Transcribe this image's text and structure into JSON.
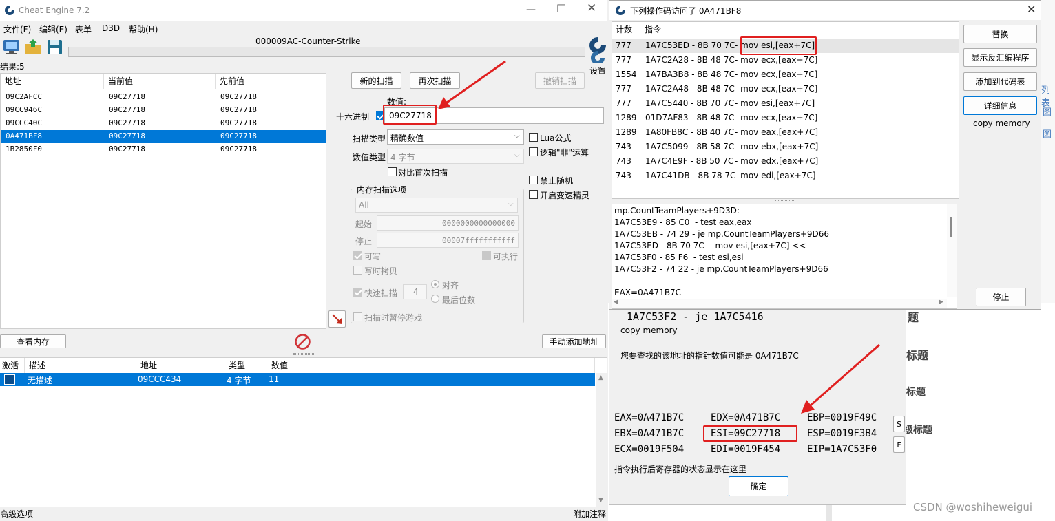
{
  "main": {
    "title": "Cheat Engine 7.2",
    "menu": [
      "文件(F)",
      "编辑(E)",
      "表单",
      "D3D",
      "帮助(H)"
    ],
    "process": "000009AC-Counter-Strike",
    "settings_label": "设置",
    "results_label": "结果:5",
    "results_headers": [
      "地址",
      "当前值",
      "先前值"
    ],
    "results": [
      [
        "09C2AFCC",
        "09C27718",
        "09C27718"
      ],
      [
        "09CC946C",
        "09C27718",
        "09C27718"
      ],
      [
        "09CCC40C",
        "09C27718",
        "09C27718"
      ],
      [
        "0A471BF8",
        "09C27718",
        "09C27718"
      ],
      [
        "1B2850F0",
        "09C27718",
        "09C27718"
      ]
    ],
    "new_scan": "新的扫描",
    "next_scan": "再次扫描",
    "undo_scan": "撤销扫描",
    "value_label": "数值:",
    "hex_label": "十六进制",
    "value": "09C27718",
    "scan_type_label": "扫描类型",
    "scan_type": "精确数值",
    "value_type_label": "数值类型",
    "value_type": "4 字节",
    "compare_first": "对比首次扫描",
    "lua_formula": "Lua公式",
    "logic_not": "逻辑\"非\"运算",
    "no_random": "禁止随机",
    "speedhack": "开启变速精灵",
    "mem_options": "内存扫描选项",
    "mem_region": "All",
    "start_label": "起始",
    "start_value": "0000000000000000",
    "stop_label": "停止",
    "stop_value": "00007fffffffffff",
    "writable": "可写",
    "executable": "可执行",
    "copy_on_write": "写时拷贝",
    "fast_scan": "快速扫描",
    "fast_scan_value": "4",
    "align": "对齐",
    "last_digits": "最后位数",
    "pause_game": "扫描时暂停游戏",
    "view_memory": "查看内存",
    "add_address": "手动添加地址",
    "table_headers": [
      "激活",
      "描述",
      "地址",
      "类型",
      "数值"
    ],
    "table_row": {
      "desc": "无描述",
      "addr": "09CCC434",
      "type": "4 字节",
      "value": "11"
    },
    "advanced": "高级选项",
    "comments": "附加注释"
  },
  "dialog": {
    "title": "下列操作码访问了 0A471BF8",
    "headers": [
      "计数",
      "指令"
    ],
    "rows": [
      {
        "count": "777",
        "addr": "1A7C53ED - 8B 70 7C",
        "instr": "- mov esi,[eax+7C]"
      },
      {
        "count": "777",
        "addr": "1A7C2A28 - 8B 48 7C",
        "instr": "- mov ecx,[eax+7C]"
      },
      {
        "count": "1554",
        "addr": "1A7BA3B8 - 8B 48 7C",
        "instr": "- mov ecx,[eax+7C]"
      },
      {
        "count": "777",
        "addr": "1A7C2A48 - 8B 48 7C",
        "instr": "- mov ecx,[eax+7C]"
      },
      {
        "count": "777",
        "addr": "1A7C5440 - 8B 70 7C",
        "instr": "- mov esi,[eax+7C]"
      },
      {
        "count": "1289",
        "addr": "01D7AF83 - 8B 48 7C",
        "instr": "- mov ecx,[eax+7C]"
      },
      {
        "count": "1289",
        "addr": "1A80FB8C - 8B 40 7C",
        "instr": "- mov eax,[eax+7C]"
      },
      {
        "count": "743",
        "addr": "1A7C5099 - 8B 58 7C",
        "instr": "- mov ebx,[eax+7C]"
      },
      {
        "count": "743",
        "addr": "1A7C4E9F - 8B 50 7C",
        "instr": "- mov edx,[eax+7C]"
      },
      {
        "count": "743",
        "addr": "1A7C41DB - 8B 78 7C",
        "instr": "- mov edi,[eax+7C]"
      }
    ],
    "buttons": [
      "替换",
      "显示反汇编程序",
      "添加到代码表",
      "详细信息"
    ],
    "copy_memory": "copy memory",
    "stop": "停止",
    "detail_lines": [
      "mp.CountTeamPlayers+9D3D:",
      "1A7C53E9 - 85 C0  - test eax,eax",
      "1A7C53EB - 74 29 - je mp.CountTeamPlayers+9D66",
      "1A7C53ED - 8B 70 7C  - mov esi,[eax+7C] <<",
      "1A7C53F0 - 85 F6  - test esi,esi",
      "1A7C53F2 - 74 22 - je mp.CountTeamPlayers+9D66",
      "",
      "EAX=0A471B7C"
    ]
  },
  "info": {
    "code_line": "1A7C53F2 - je 1A7C5416",
    "copy_memory": "copy memory",
    "pointer_hint": "您要查找的该地址的指针数值可能是 0A471B7C",
    "registers": [
      [
        "EAX=0A471B7C",
        "EDX=0A471B7C",
        "EBP=0019F49C"
      ],
      [
        "EBX=0A471B7C",
        "ESI=09C27718",
        "ESP=0019F3B4"
      ],
      [
        "ECX=0019F504",
        "EDI=0019F454",
        "EIP=1A7C53F0"
      ]
    ],
    "s_btn": "S",
    "f_btn": "F",
    "state_hint": "指令执行后寄存器的状态显示在这里",
    "ok": "确定"
  },
  "background": {
    "items": [
      "题",
      "标题",
      "标题",
      "级标题"
    ],
    "right_edge": [
      "列表",
      "图",
      "图"
    ],
    "watermark": "CSDN @woshiheweigui"
  },
  "colors": {
    "selection": "#0078d7",
    "annotation": "#e02020"
  }
}
